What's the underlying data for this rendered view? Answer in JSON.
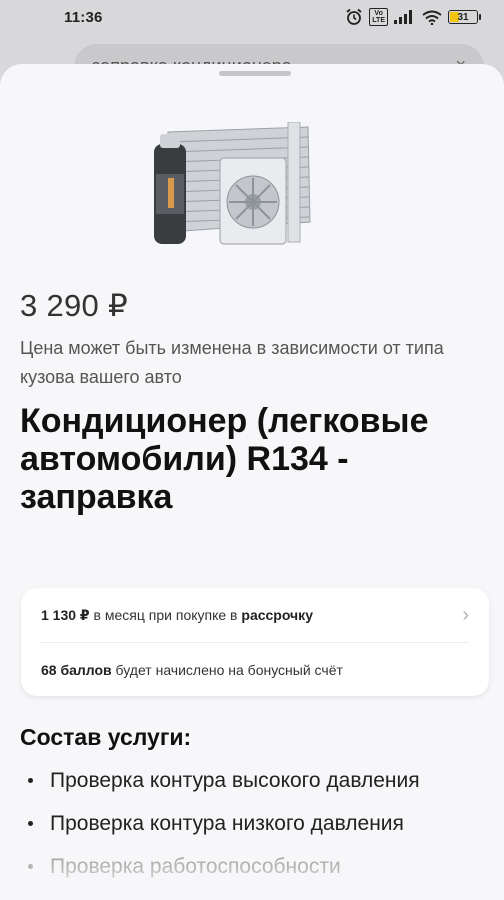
{
  "status_bar": {
    "time": "11:36",
    "volte": "Vo\nLTE",
    "battery": "31",
    "battery_level_percent": 31,
    "battery_color": "#f1c40f"
  },
  "background": {
    "search_text": "заправка кондиционера",
    "clear": "×",
    "back": "‹"
  },
  "product": {
    "price": "3 290 ₽",
    "price_note": "Цена может быть изменена в зависимости от типа кузова вашего авто",
    "title": "Кондиционер (легковые автомобили) R134 - заправка",
    "installment": {
      "amount": "1 130 ₽",
      "text": " в месяц при покупке в ",
      "link": "рассрочку",
      "chevron": "›"
    },
    "bonus": {
      "points": "68 баллов",
      "text": " будет начислено на бонусный счёт"
    }
  },
  "services": {
    "title": "Состав услуги:",
    "items": [
      "Проверка контура высокого давления",
      "Проверка контура низкого давления",
      "Проверка работоспособности"
    ]
  }
}
